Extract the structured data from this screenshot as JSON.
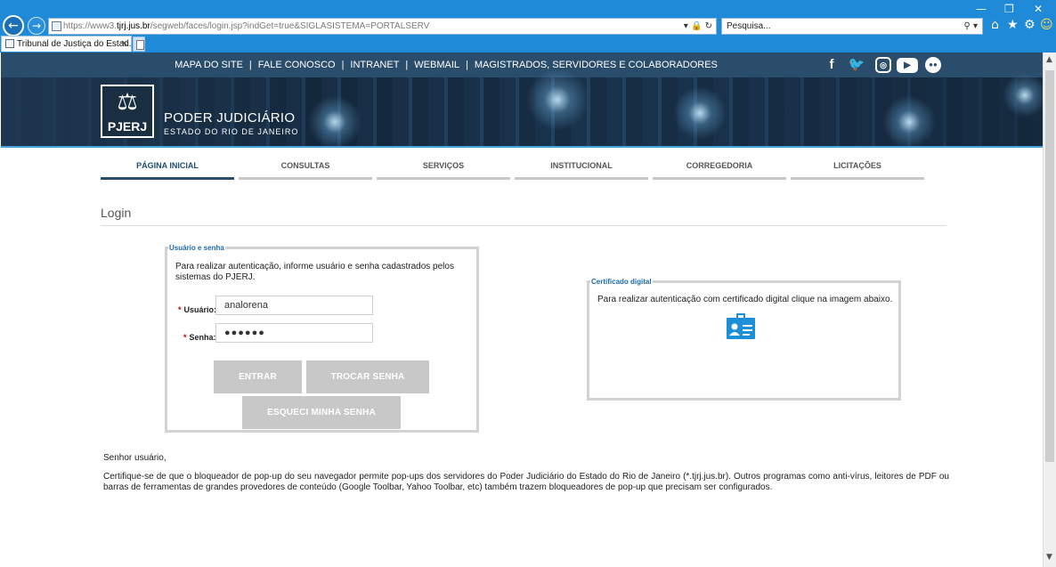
{
  "browser": {
    "url_prefix": "https://www3.",
    "url_host": "tjrj.jus.br",
    "url_path": "/segweb/faces/login.jsp?indGet=true&SIGLASISTEMA=PORTALSERV",
    "search_placeholder": "Pesquisa...",
    "tab_title": "Tribunal de Justiça do Estad...",
    "icons": [
      "back-icon",
      "forward-icon",
      "dropdown-icon",
      "lock-icon",
      "refresh-icon",
      "search-icon",
      "home-icon",
      "star-icon",
      "gear-icon",
      "smiley-icon",
      "minimize-icon",
      "restore-icon",
      "close-icon"
    ]
  },
  "header": {
    "links": [
      "MAPA DO SITE",
      "FALE CONOSCO",
      "INTRANET",
      "WEBMAIL",
      "MAGISTRADOS, SERVIDORES E COLABORADORES"
    ],
    "social": [
      "facebook-icon",
      "twitter-icon",
      "instagram-icon",
      "youtube-icon",
      "flickr-icon"
    ],
    "logo_text": "PJERJ",
    "title": "PODER JUDICIÁRIO",
    "subtitle": "ESTADO DO RIO DE JANEIRO"
  },
  "nav": {
    "items": [
      "PÁGINA INICIAL",
      "CONSULTAS",
      "SERVIÇOS",
      "INSTITUCIONAL",
      "CORREGEDORIA",
      "LICITAÇÕES"
    ],
    "active_index": 0
  },
  "page": {
    "title": "Login"
  },
  "login_form": {
    "legend": "Usuário e senha",
    "intro": "Para realizar autenticação, informe usuário e senha cadastrados pelos sistemas do PJERJ.",
    "required_mark": "*",
    "user_label": "Usuário:",
    "user_value": "analorena",
    "password_label": "Senha:",
    "password_value": "●●●●●●",
    "enter_button": "ENTRAR",
    "change_password_button": "TROCAR SENHA",
    "forgot_password_button": "ESQUECI MINHA SENHA"
  },
  "certificate": {
    "legend": "Certificado digital",
    "text": "Para realizar autenticação com certificado digital clique na imagem abaixo.",
    "icon": "id-card-icon"
  },
  "notice": {
    "title": "Senhor usuário,",
    "body": "Certifique-se de que o bloqueador de pop-up do seu navegador permite pop-ups dos servidores do Poder Judiciário do Estado do Rio de Janeiro (*.tjrj.jus.br). Outros programas como anti-vírus, leitores de PDF ou barras de ferramentas de grandes provedores de conteúdo (Google Toolbar, Yahoo Toolbar, etc) também trazem bloqueadores de pop-up que precisam ser configurados."
  },
  "colors": {
    "chrome_blue": "#1f8bd8",
    "header_navy": "#2a4d6c",
    "accent_blue": "#1c6bad",
    "button_gray": "#c8c8c8"
  }
}
